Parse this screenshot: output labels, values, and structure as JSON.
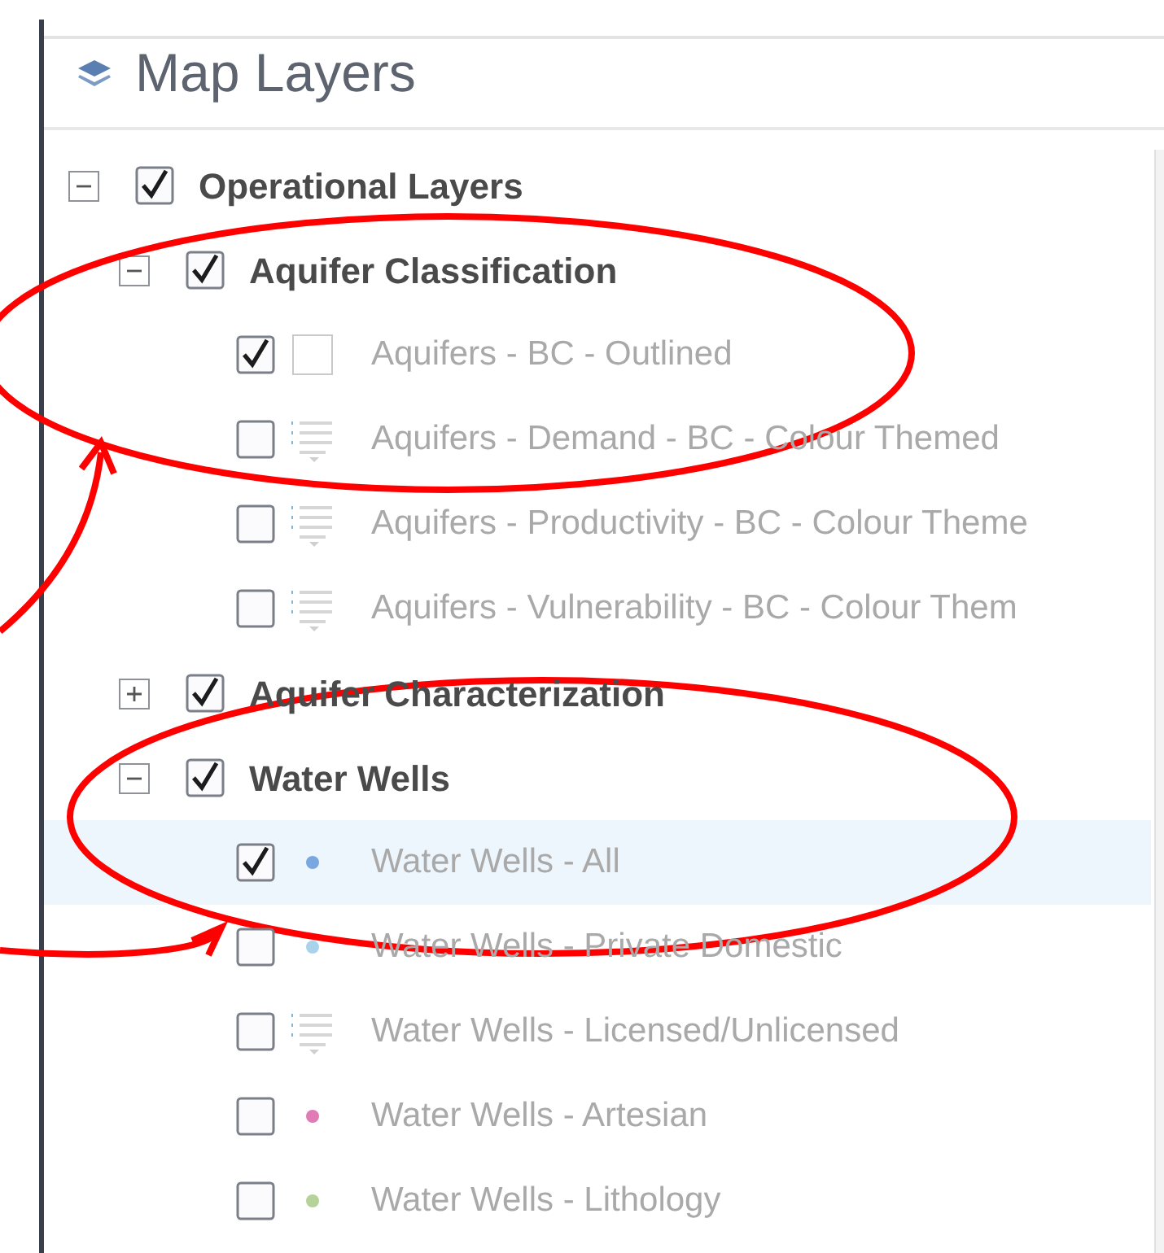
{
  "panel": {
    "title": "Map Layers"
  },
  "layers": [
    {
      "label": "Operational Layers",
      "expanded": true,
      "checked": true,
      "children": [
        {
          "label": "Aquifer Classification",
          "expanded": true,
          "checked": true,
          "children": [
            {
              "label": "Aquifers - BC - Outlined",
              "checked": true,
              "selected": false,
              "kind": "box"
            },
            {
              "label": "Aquifers - Demand - BC - Colour Themed",
              "checked": false,
              "selected": false,
              "kind": "legend"
            },
            {
              "label": "Aquifers - Productivity - BC - Colour Theme",
              "checked": false,
              "selected": false,
              "kind": "legend"
            },
            {
              "label": "Aquifers - Vulnerability - BC - Colour Them",
              "checked": false,
              "selected": false,
              "kind": "legend"
            }
          ]
        },
        {
          "label": "Aquifer Characterization",
          "expanded": false,
          "checked": true
        },
        {
          "label": "Water Wells",
          "expanded": true,
          "checked": true,
          "children": [
            {
              "label": "Water Wells - All",
              "checked": true,
              "selected": true,
              "kind": "dot",
              "color": "#7aa7e0"
            },
            {
              "label": "Water Wells - Private Domestic",
              "checked": false,
              "selected": false,
              "kind": "dot",
              "color": "#a9d3ea"
            },
            {
              "label": "Water Wells - Licensed/Unlicensed",
              "checked": false,
              "selected": false,
              "kind": "legend"
            },
            {
              "label": "Water Wells - Artesian",
              "checked": false,
              "selected": false,
              "kind": "dot",
              "color": "#e07bb5"
            },
            {
              "label": "Water Wells - Lithology",
              "checked": false,
              "selected": false,
              "kind": "dot",
              "color": "#b5d29a"
            }
          ]
        }
      ]
    }
  ],
  "annotations": [
    {
      "kind": "ellipse"
    },
    {
      "kind": "ellipse"
    },
    {
      "kind": "arrow"
    },
    {
      "kind": "arrow"
    }
  ]
}
